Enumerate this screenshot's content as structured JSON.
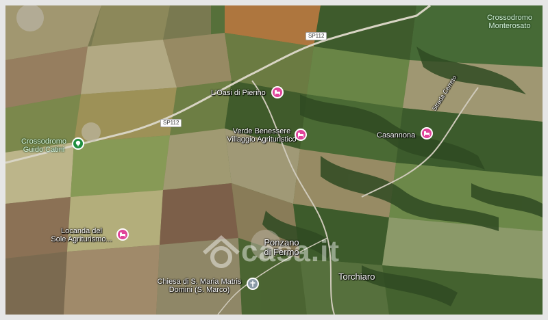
{
  "map": {
    "roads": [
      "SP112",
      "SP112"
    ],
    "places": [
      {
        "label_lines": [
          "Crossodromo",
          "Monterosato"
        ],
        "kind": "park"
      },
      {
        "label_lines": [
          "L'Oasi di Pierino"
        ],
        "kind": "hotel"
      },
      {
        "label_lines": [
          "Verde Benessere",
          "Villaggio Agrituristico"
        ],
        "kind": "hotel"
      },
      {
        "label_lines": [
          "Casannona"
        ],
        "kind": "hotel"
      },
      {
        "label_lines": [
          "Crossodromo",
          "Guido Catini"
        ],
        "kind": "park"
      },
      {
        "label_lines": [
          "Locanda del",
          "Sole Agriturismo..."
        ],
        "kind": "hotel"
      },
      {
        "label_lines": [
          "Chiesa di S. Maria Matris",
          "Domini (S. Marco)"
        ],
        "kind": "church"
      }
    ],
    "towns": [
      {
        "label_lines": [
          "Ponzano",
          "di Fermo"
        ]
      },
      {
        "label_lines": [
          "Torchiaro"
        ]
      }
    ],
    "street_label": "Strada Cerreto",
    "watermark": "casa.it",
    "colors": {
      "hotel_pin": "#e0449a",
      "park_pin": "#1e8e3e",
      "church_pin": "#8a9aa6"
    }
  }
}
